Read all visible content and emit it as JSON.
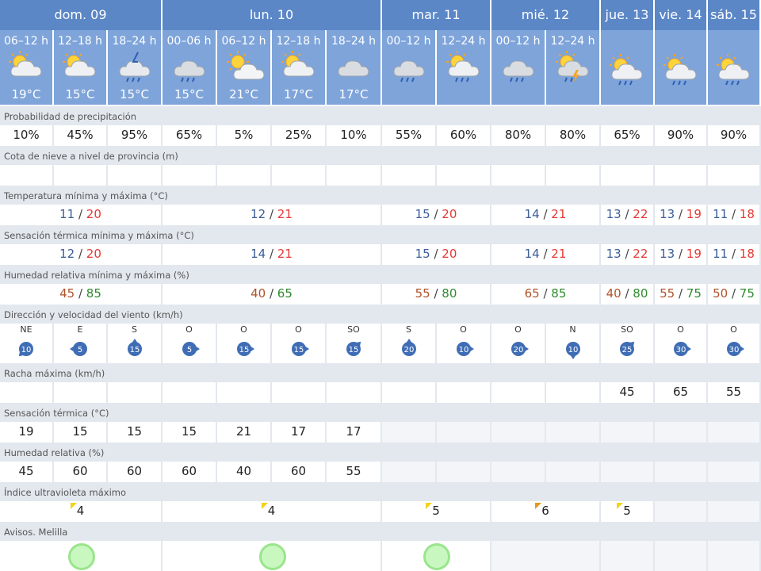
{
  "days": [
    {
      "label": "dom. 09",
      "periods": [
        {
          "period": "06–12 h",
          "temp": "19°C",
          "icon": "partly-cloudy-icon"
        },
        {
          "period": "12–18 h",
          "temp": "15°C",
          "icon": "partly-cloudy-icon"
        },
        {
          "period": "18–24 h",
          "temp": "15°C",
          "icon": "storm-rain-icon"
        }
      ]
    },
    {
      "label": "lun. 10",
      "periods": [
        {
          "period": "00–06 h",
          "temp": "15°C",
          "icon": "cloud-rain-icon"
        },
        {
          "period": "06–12 h",
          "temp": "21°C",
          "icon": "sun-cloud-icon"
        },
        {
          "period": "12–18 h",
          "temp": "17°C",
          "icon": "partly-cloudy-icon"
        },
        {
          "period": "18–24 h",
          "temp": "17°C",
          "icon": "cloud-icon"
        }
      ]
    },
    {
      "label": "mar. 11",
      "periods": [
        {
          "period": "00–12 h",
          "temp": "",
          "icon": "cloud-rain-icon"
        },
        {
          "period": "12–24 h",
          "temp": "",
          "icon": "sun-cloud-rain-icon"
        }
      ]
    },
    {
      "label": "mié. 12",
      "periods": [
        {
          "period": "00–12 h",
          "temp": "",
          "icon": "cloud-rain-icon"
        },
        {
          "period": "12–24 h",
          "temp": "",
          "icon": "sun-cloud-storm-icon"
        }
      ]
    },
    {
      "label": "jue. 13",
      "periods": [
        {
          "period": "",
          "temp": "",
          "icon": "sun-cloud-rain-icon"
        }
      ]
    },
    {
      "label": "vie. 14",
      "periods": [
        {
          "period": "",
          "temp": "",
          "icon": "sun-cloud-rain-icon"
        }
      ]
    },
    {
      "label": "sáb. 15",
      "periods": [
        {
          "period": "",
          "temp": "",
          "icon": "sun-cloud-rain-icon"
        }
      ]
    }
  ],
  "rows": {
    "precip": {
      "label": "Probabilidad de precipitación",
      "values": [
        "10%",
        "45%",
        "95%",
        "65%",
        "5%",
        "25%",
        "10%",
        "55%",
        "60%",
        "80%",
        "80%",
        "65%",
        "90%",
        "90%"
      ]
    },
    "snow": {
      "label": "Cota de nieve a nivel de provincia (m)",
      "values": [
        "",
        "",
        "",
        "",
        "",
        "",
        "",
        "",
        "",
        "",
        "",
        "",
        "",
        ""
      ]
    },
    "temp": {
      "label": "Temperatura mínima y máxima (°C)",
      "values": [
        {
          "min": "11",
          "max": "20"
        },
        {
          "min": "12",
          "max": "21"
        },
        {
          "min": "15",
          "max": "20"
        },
        {
          "min": "14",
          "max": "21"
        },
        {
          "min": "13",
          "max": "22"
        },
        {
          "min": "13",
          "max": "19"
        },
        {
          "min": "11",
          "max": "18"
        }
      ]
    },
    "feel": {
      "label": "Sensación térmica mínima y máxima (°C)",
      "values": [
        {
          "min": "12",
          "max": "20"
        },
        {
          "min": "14",
          "max": "21"
        },
        {
          "min": "15",
          "max": "20"
        },
        {
          "min": "14",
          "max": "21"
        },
        {
          "min": "13",
          "max": "22"
        },
        {
          "min": "13",
          "max": "19"
        },
        {
          "min": "11",
          "max": "18"
        }
      ]
    },
    "hum": {
      "label": "Humedad relativa mínima y máxima (%)",
      "values": [
        {
          "min": "45",
          "max": "85"
        },
        {
          "min": "40",
          "max": "65"
        },
        {
          "min": "55",
          "max": "80"
        },
        {
          "min": "65",
          "max": "85"
        },
        {
          "min": "40",
          "max": "80"
        },
        {
          "min": "55",
          "max": "75"
        },
        {
          "min": "50",
          "max": "75"
        }
      ]
    },
    "wind": {
      "label": "Dirección y velocidad del viento (km/h)",
      "values": [
        {
          "dir": "NE",
          "speed": "10"
        },
        {
          "dir": "E",
          "speed": "5"
        },
        {
          "dir": "S",
          "speed": "15"
        },
        {
          "dir": "O",
          "speed": "5"
        },
        {
          "dir": "O",
          "speed": "15"
        },
        {
          "dir": "O",
          "speed": "15"
        },
        {
          "dir": "SO",
          "speed": "15"
        },
        {
          "dir": "S",
          "speed": "20"
        },
        {
          "dir": "O",
          "speed": "10"
        },
        {
          "dir": "O",
          "speed": "20"
        },
        {
          "dir": "N",
          "speed": "10"
        },
        {
          "dir": "SO",
          "speed": "25"
        },
        {
          "dir": "O",
          "speed": "30"
        },
        {
          "dir": "O",
          "speed": "30"
        }
      ]
    },
    "gust": {
      "label": "Racha máxima (km/h)",
      "values": [
        "",
        "",
        "",
        "",
        "",
        "",
        "",
        "",
        "",
        "",
        "",
        "45",
        "65",
        "55"
      ]
    },
    "feelh": {
      "label": "Sensación térmica (°C)",
      "values": [
        "19",
        "15",
        "15",
        "15",
        "21",
        "17",
        "17"
      ]
    },
    "humh": {
      "label": "Humedad relativa (%)",
      "values": [
        "45",
        "60",
        "60",
        "60",
        "40",
        "60",
        "55"
      ]
    },
    "uv": {
      "label": "Índice ultravioleta máximo",
      "values": [
        "4",
        "4",
        "5",
        "6",
        "5",
        "",
        ""
      ],
      "colors": [
        "#f2d21b",
        "#f2d21b",
        "#f2d21b",
        "#e8961b",
        "#f2d21b",
        "",
        ""
      ]
    },
    "avisos": {
      "label": "Avisos. Melilla",
      "values": [
        "green",
        "green",
        "green",
        "",
        "",
        "",
        ""
      ]
    }
  },
  "colors": {
    "header": "#5b87c7",
    "subheader": "#7ea4da",
    "label_bg": "#e3e8ee",
    "min": "#3a5d99",
    "max": "#e53935",
    "wind_icon": "#3f6db5"
  }
}
